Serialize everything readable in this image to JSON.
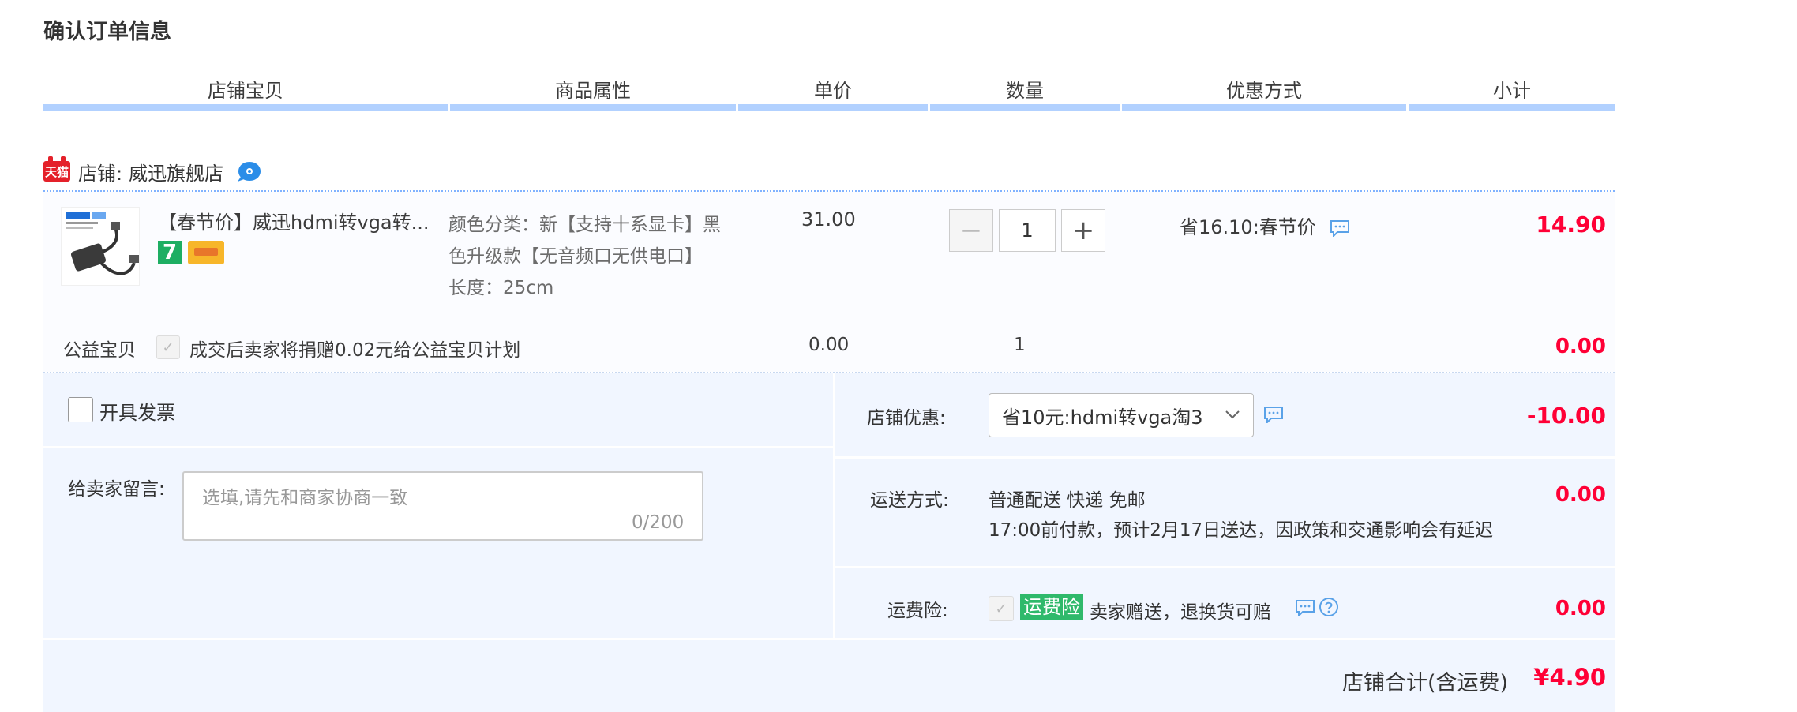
{
  "page": {
    "title": "确认订单信息"
  },
  "columns": [
    "店铺宝贝",
    "商品属性",
    "单价",
    "数量",
    "优惠方式",
    "小计"
  ],
  "shop": {
    "badge": "天猫",
    "label": "店铺:",
    "name": "威迅旗舰店",
    "item": {
      "title": "【春节价】威迅hdmi转vga转...",
      "badge7": "7",
      "attr_line1": "颜色分类：新【支持十系显卡】黑",
      "attr_line2": "色升级款【无音频口无供电口】",
      "attr_line3": "长度：25cm",
      "price": "31.00",
      "quantity": "1",
      "minus": "−",
      "plus": "+",
      "promo": "省16.10:春节价",
      "subtotal": "14.90"
    },
    "charity": {
      "label": "公益宝贝",
      "check": "✓",
      "text": "成交后卖家将捐赠0.02元给公益宝贝计划",
      "price": "0.00",
      "quantity": "1",
      "subtotal": "0.00"
    }
  },
  "invoice": {
    "label": "开具发票"
  },
  "message": {
    "label": "给卖家留言:",
    "placeholder": "选填,请先和商家协商一致",
    "count": "0/200"
  },
  "shop_discount": {
    "label": "店铺优惠:",
    "selected": "省10元:hdmi转vga淘3",
    "amount": "-10.00"
  },
  "shipping": {
    "label": "运送方式:",
    "line1": "普通配送 快递 免邮",
    "line2": "17:00前付款，预计2月17日送达，因政策和交通影响会有延迟",
    "amount": "0.00"
  },
  "insurance": {
    "label": "运费险:",
    "check": "✓",
    "tag": "运费险",
    "text": "卖家赠送，退换货可赔",
    "amount": "0.00"
  },
  "total": {
    "label": "店铺合计(含运费)",
    "amount": "¥4.90"
  },
  "colors": {
    "accent_red": "#ff0036",
    "header_line": "#b2d1ff",
    "panel_bg": "#f1f6ff",
    "green_tag": "#2fb96b"
  }
}
